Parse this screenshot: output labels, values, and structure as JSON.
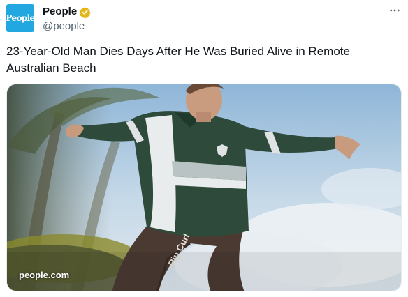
{
  "author": {
    "avatar_text": "People",
    "display_name": "People",
    "handle": "@people",
    "verified": true,
    "verified_badge_color": "#e2b719",
    "avatar_color": "#22a7e0"
  },
  "more_icon": "more-horizontal-icon",
  "tweet": {
    "text": "23-Year-Old Man Dies Days After He Was Buried Alive in Remote Australian Beach"
  },
  "media": {
    "card_domain": "people.com",
    "shirt_text": "Rip Curl"
  }
}
